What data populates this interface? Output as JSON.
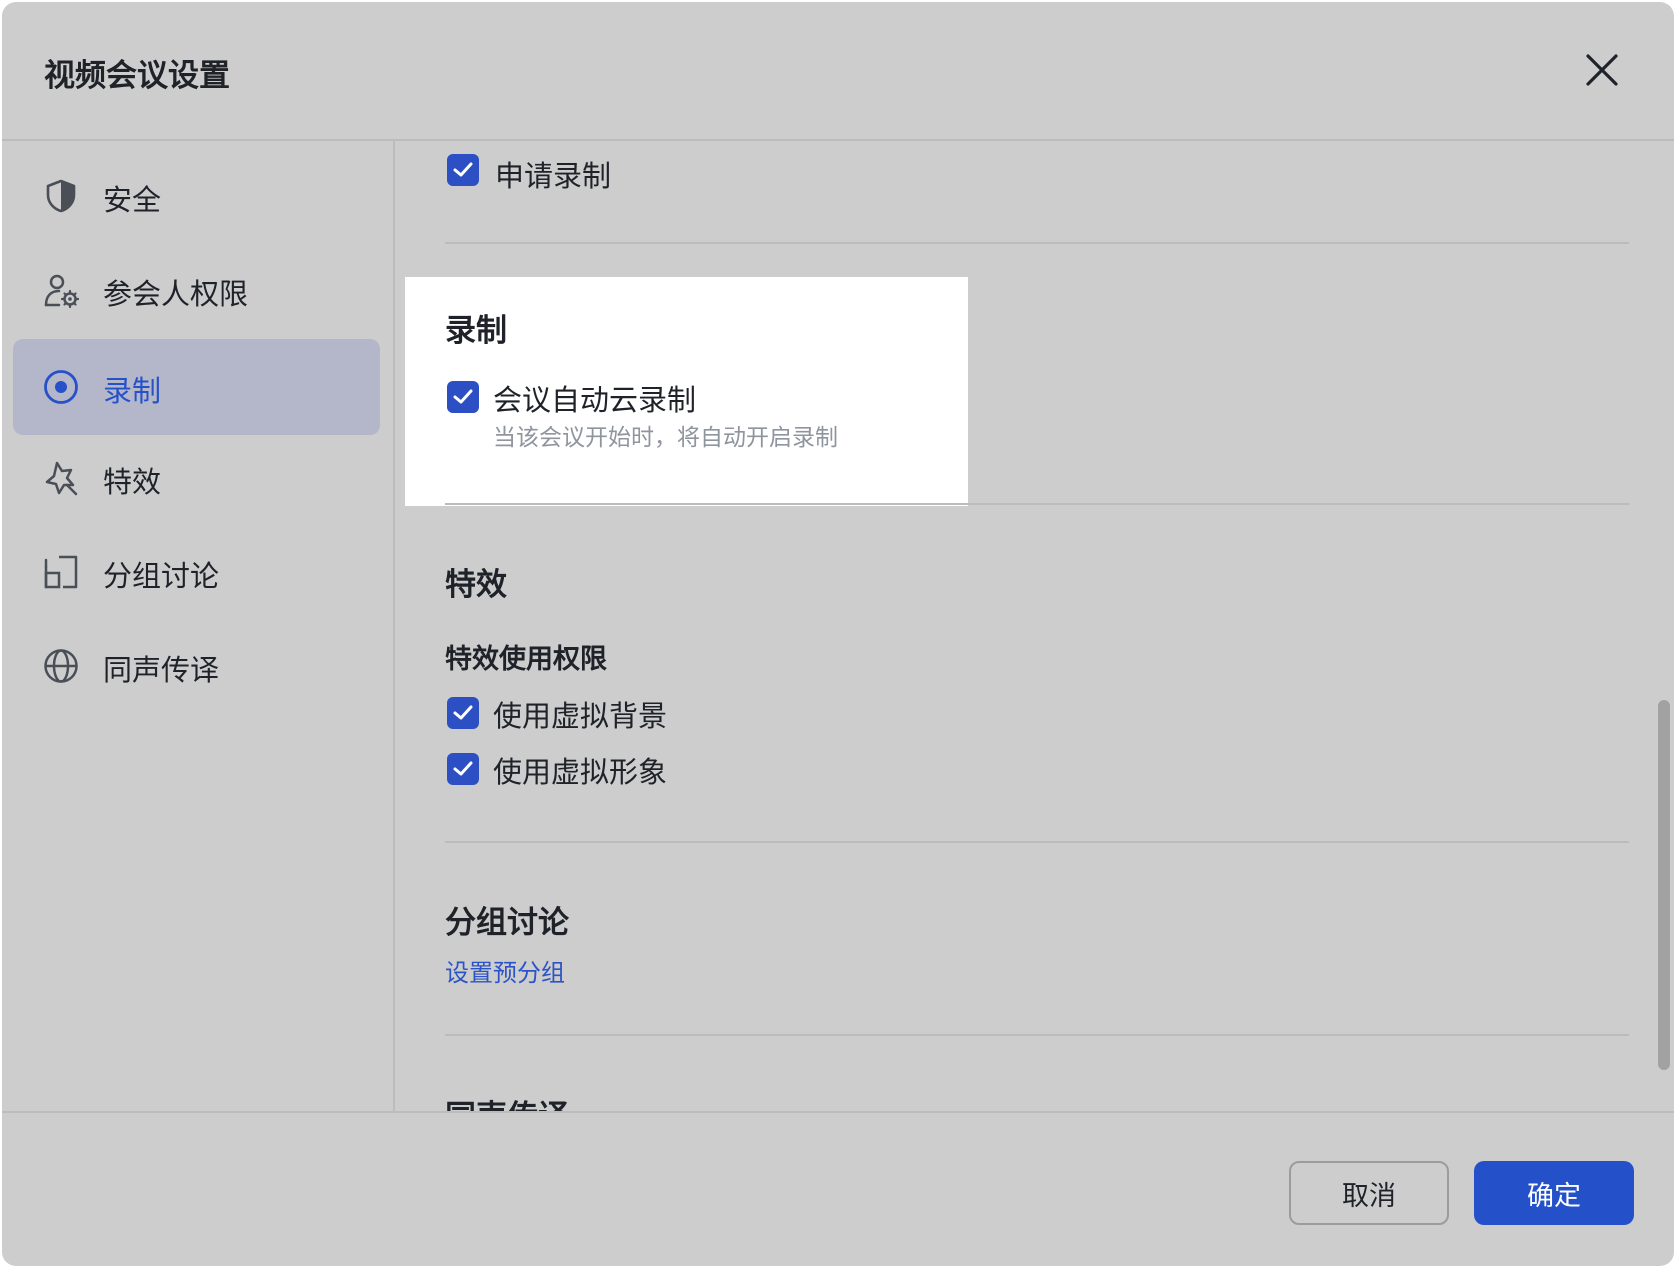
{
  "dialog": {
    "title": "视频会议设置"
  },
  "sidebar": {
    "items": [
      {
        "label": "安全",
        "icon": "shield-icon",
        "active": false
      },
      {
        "label": "参会人权限",
        "icon": "participant-settings-icon",
        "active": false
      },
      {
        "label": "录制",
        "icon": "record-icon",
        "active": true
      },
      {
        "label": "特效",
        "icon": "effects-icon",
        "active": false
      },
      {
        "label": "分组讨论",
        "icon": "breakout-room-icon",
        "active": false
      },
      {
        "label": "同声传译",
        "icon": "globe-icon",
        "active": false
      }
    ]
  },
  "content": {
    "request_recording": {
      "label": "申请录制",
      "checked": true
    },
    "recording": {
      "title": "录制",
      "auto_cloud": {
        "label": "会议自动云录制",
        "hint": "当该会议开始时，将自动开启录制",
        "checked": true
      }
    },
    "effects": {
      "title": "特效",
      "permission_title": "特效使用权限",
      "virtual_background": {
        "label": "使用虚拟背景",
        "checked": true
      },
      "virtual_avatar": {
        "label": "使用虚拟形象",
        "checked": true
      }
    },
    "breakout": {
      "title": "分组讨论",
      "link": "设置预分组"
    },
    "interpretation": {
      "title": "同声传译"
    }
  },
  "footer": {
    "cancel_label": "取消",
    "ok_label": "确定"
  },
  "colors": {
    "accent": "#2451c9",
    "dialog_bg": "#cdcdcd",
    "active_nav_bg": "#b3b7c9",
    "highlight_bg": "#ffffff"
  }
}
